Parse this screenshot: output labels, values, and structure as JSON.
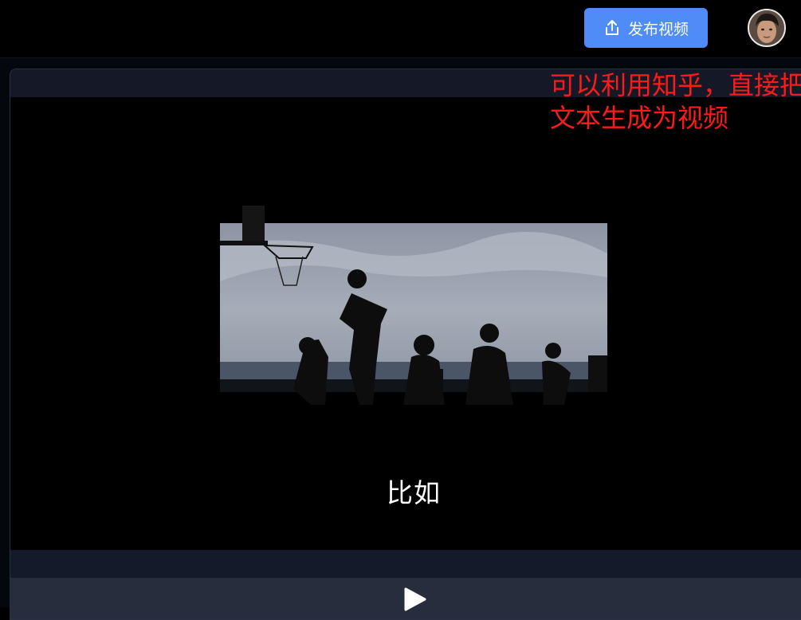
{
  "header": {
    "publish_label": "发布视频",
    "publish_icon": "upload-share-icon",
    "avatar_icon": "user-avatar"
  },
  "video": {
    "caption": "比如",
    "play_icon": "play-icon"
  },
  "annotation": {
    "line1": "可以利用知乎，直接把",
    "line2": "文本生成为视频",
    "color": "#ff1a1a"
  },
  "colors": {
    "accent": "#4f8cf7",
    "card": "#141827",
    "controls": "#272d3d"
  }
}
